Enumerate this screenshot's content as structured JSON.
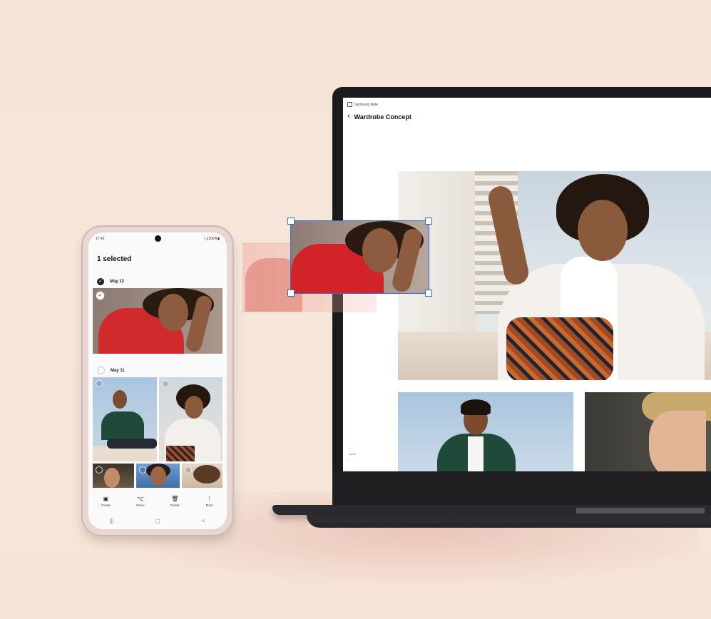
{
  "laptop": {
    "app_name": "Samsung Note",
    "note_title": "Wardrobe Concept",
    "side_marks": [
      "+",
      "100%",
      "–"
    ]
  },
  "phone": {
    "status": {
      "time": "17:41",
      "indicators": "≈.∥100%▮"
    },
    "selection_title": "1 selected",
    "groups": [
      {
        "date": "May 12"
      },
      {
        "date": "May 11"
      }
    ],
    "actions": [
      {
        "icon": "create-icon",
        "glyph": "▣",
        "label": "Create"
      },
      {
        "icon": "share-icon",
        "glyph": "⌥",
        "label": "Share"
      },
      {
        "icon": "delete-icon",
        "glyph": "🗑",
        "label": "Delete"
      },
      {
        "icon": "more-icon",
        "glyph": "⋮",
        "label": "More"
      }
    ],
    "nav": [
      {
        "icon": "recents-icon",
        "glyph": "|||"
      },
      {
        "icon": "home-icon",
        "glyph": "▢"
      },
      {
        "icon": "back-icon",
        "glyph": "<"
      }
    ]
  },
  "colors": {
    "background": "#f5e5d8",
    "selection_outline": "#2f6fd1",
    "laptop_body": "#1b1b1d",
    "phone_body": "#e7d6d2"
  }
}
